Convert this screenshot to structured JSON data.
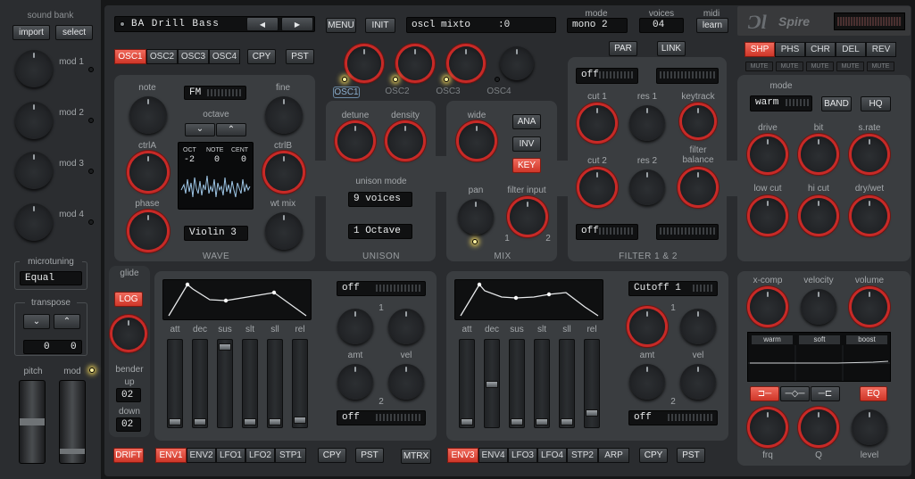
{
  "left": {
    "sound_bank": "sound bank",
    "import": "import",
    "select": "select",
    "mods": [
      "mod 1",
      "mod 2",
      "mod 3",
      "mod 4"
    ],
    "microtuning": "microtuning",
    "microtuning_value": "Equal",
    "transpose": "transpose",
    "transpose_down": "⌄",
    "transpose_up": "⌃",
    "transpose_left": "0",
    "transpose_right": "0",
    "pitch": "pitch",
    "mod": "mod"
  },
  "top": {
    "preset": "BA Drill Bass",
    "prev": "◀",
    "next": "▶",
    "menu": "MENU",
    "init": "INIT",
    "param_display": "oscl mixto",
    "param_value": ":0",
    "mode_label": "mode",
    "mode_value": "mono 2",
    "voices_label": "voices",
    "voices_value": "04",
    "midi_label": "midi",
    "learn": "learn",
    "logo": "Spire"
  },
  "osc": {
    "tabs": [
      "OSC1",
      "OSC2",
      "OSC3",
      "OSC4"
    ],
    "copy": "CPY",
    "paste": "PST",
    "knob_leds": [
      "OSC1",
      "OSC2",
      "OSC3",
      "OSC4"
    ],
    "note": "note",
    "fm_type": "FM",
    "fine": "fine",
    "octave": "octave",
    "oct_down": "⌄",
    "oct_up": "⌃",
    "ctrlA": "ctrlA",
    "ctrlB": "ctrlB",
    "disp_oct": "OCT",
    "disp_note": "NOTE",
    "disp_cent": "CENT",
    "val_oct": "-2",
    "val_note": "0",
    "val_cent": "0",
    "phase": "phase",
    "wavetable": "Violin 3",
    "wt_mix": "wt mix",
    "wave_title": "WAVE"
  },
  "unison": {
    "detune": "detune",
    "density": "density",
    "mode_label": "unison mode",
    "voices": "9 voices",
    "octave": "1 Octave",
    "title": "UNISON"
  },
  "mix": {
    "wide": "wide",
    "ana": "ANA",
    "inv": "INV",
    "key": "KEY",
    "pan": "pan",
    "filter_input": "filter input",
    "in1": "1",
    "in2": "2",
    "title": "MIX"
  },
  "filter": {
    "par": "PAR",
    "link": "LINK",
    "type1": "off",
    "cut1": "cut 1",
    "res1": "res 1",
    "keytrack": "keytrack",
    "cut2": "cut 2",
    "res2": "res 2",
    "balance": "filter\nbalance",
    "type2": "off",
    "title": "FILTER 1 & 2"
  },
  "fx": {
    "tabs": [
      "SHP",
      "PHS",
      "CHR",
      "DEL",
      "REV"
    ],
    "mutes": [
      "MUTE",
      "MUTE",
      "MUTE",
      "MUTE",
      "MUTE"
    ],
    "mode_label": "mode",
    "mode_value": "warm",
    "band": "BAND",
    "hq": "HQ",
    "knobs": [
      "drive",
      "bit",
      "s.rate",
      "low cut",
      "hi cut",
      "dry/wet"
    ]
  },
  "glide": {
    "label": "glide",
    "log": "LOG",
    "bender": "bender",
    "up": "up",
    "up_value": "02",
    "down": "down",
    "down_value": "02"
  },
  "env1": {
    "labels": [
      "att",
      "dec",
      "sus",
      "slt",
      "sll",
      "rel"
    ],
    "dest1": "off",
    "amt": "amt",
    "vel": "vel",
    "n1": "1",
    "n2": "2",
    "dest2": "off"
  },
  "env2": {
    "labels": [
      "att",
      "dec",
      "sus",
      "slt",
      "sll",
      "rel"
    ],
    "dest1": "Cutoff 1",
    "amt": "amt",
    "vel": "vel",
    "n1": "1",
    "n2": "2",
    "dest2": "off"
  },
  "eq": {
    "xcomp": "x-comp",
    "velocity": "velocity",
    "volume": "volume",
    "presets": [
      "warm",
      "soft",
      "boost"
    ],
    "eq_btn": "EQ",
    "frq": "frq",
    "q": "Q",
    "level": "level"
  },
  "bottom": {
    "drift": "DRIFT",
    "tabs1": [
      "ENV1",
      "ENV2",
      "LFO1",
      "LFO2",
      "STP1"
    ],
    "cpy1": "CPY",
    "pst1": "PST",
    "mtrx": "MTRX",
    "tabs2": [
      "ENV3",
      "ENV4",
      "LFO3",
      "LFO4",
      "STP2",
      "ARP"
    ],
    "cpy2": "CPY",
    "pst2": "PST"
  }
}
